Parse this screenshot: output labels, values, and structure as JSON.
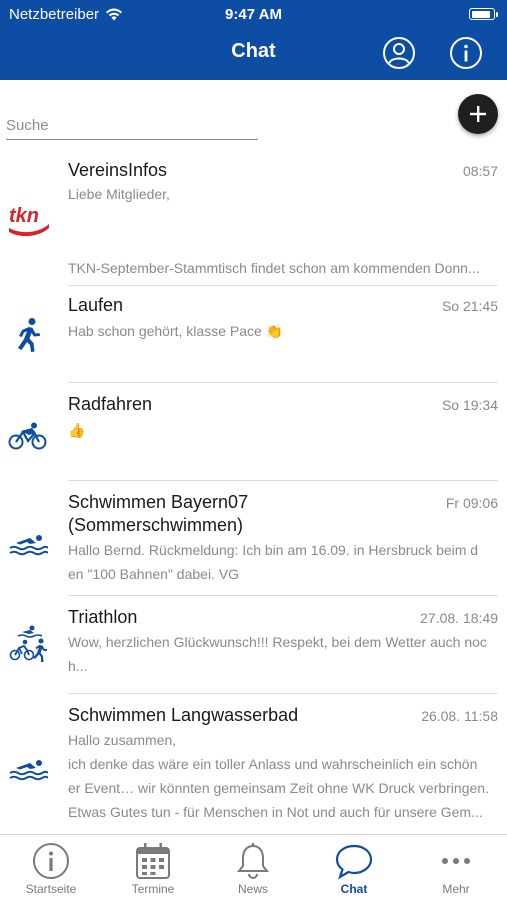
{
  "status_bar": {
    "carrier": "Netzbetreiber",
    "time": "9:47 AM",
    "battery_level": 0.9
  },
  "header": {
    "title": "Chat",
    "profile_icon": "person-circle-icon",
    "info_icon": "info-circle-icon"
  },
  "search": {
    "placeholder": "Suche",
    "value": ""
  },
  "add_button": {
    "icon": "plus-icon"
  },
  "chats": [
    {
      "name": "VereinsInfos",
      "time": "08:57",
      "icon": "tkn-logo",
      "lines": [
        "Liebe Mitglieder,",
        "",
        "",
        "TKN-September-Stammtisch findet schon am kommenden Donn..."
      ]
    },
    {
      "name": "Laufen",
      "time": "So 21:45",
      "icon": "runner-icon",
      "lines": [
        "Hab schon gehört, klasse Pace 👏"
      ]
    },
    {
      "name": "Radfahren",
      "time": "So 19:34",
      "icon": "cyclist-icon",
      "lines": [
        "👍"
      ]
    },
    {
      "name": "Schwimmen Bayern07",
      "name2": "(Sommerschwimmen)",
      "time": "Fr 09:06",
      "icon": "swimmer-icon",
      "lines": [
        "Hallo Bernd. Rückmeldung: Ich bin am 16.09. in Hersbruck beim d",
        "en \"100 Bahnen\" dabei. VG"
      ]
    },
    {
      "name": "Triathlon",
      "time": "27.08. 18:49",
      "icon": "triathlon-icon",
      "lines": [
        "Wow, herzlichen Glückwunsch!!! Respekt, bei dem Wetter auch noc",
        "h..."
      ]
    },
    {
      "name": "Schwimmen Langwasserbad",
      "time": "26.08. 11:58",
      "icon": "swimmer-icon",
      "lines": [
        "Hallo zusammen,",
        "ich denke das wäre ein toller Anlass und wahrscheinlich ein schön",
        "er Event… wir könnten gemeinsam Zeit ohne WK Druck verbringen.",
        "Etwas Gutes tun - für Menschen in Not und auch für unsere Gem..."
      ]
    }
  ],
  "tabs": [
    {
      "label": "Startseite",
      "icon": "info-circle-icon",
      "active": false
    },
    {
      "label": "Termine",
      "icon": "calendar-icon",
      "active": false
    },
    {
      "label": "News",
      "icon": "bell-icon",
      "active": false
    },
    {
      "label": "Chat",
      "icon": "chat-bubble-icon",
      "active": true
    },
    {
      "label": "Mehr",
      "icon": "more-dots-icon",
      "active": false
    }
  ],
  "colors": {
    "brand": "#0e4da4",
    "tkn_red": "#d8232a",
    "text_muted": "#8a8a8a"
  }
}
